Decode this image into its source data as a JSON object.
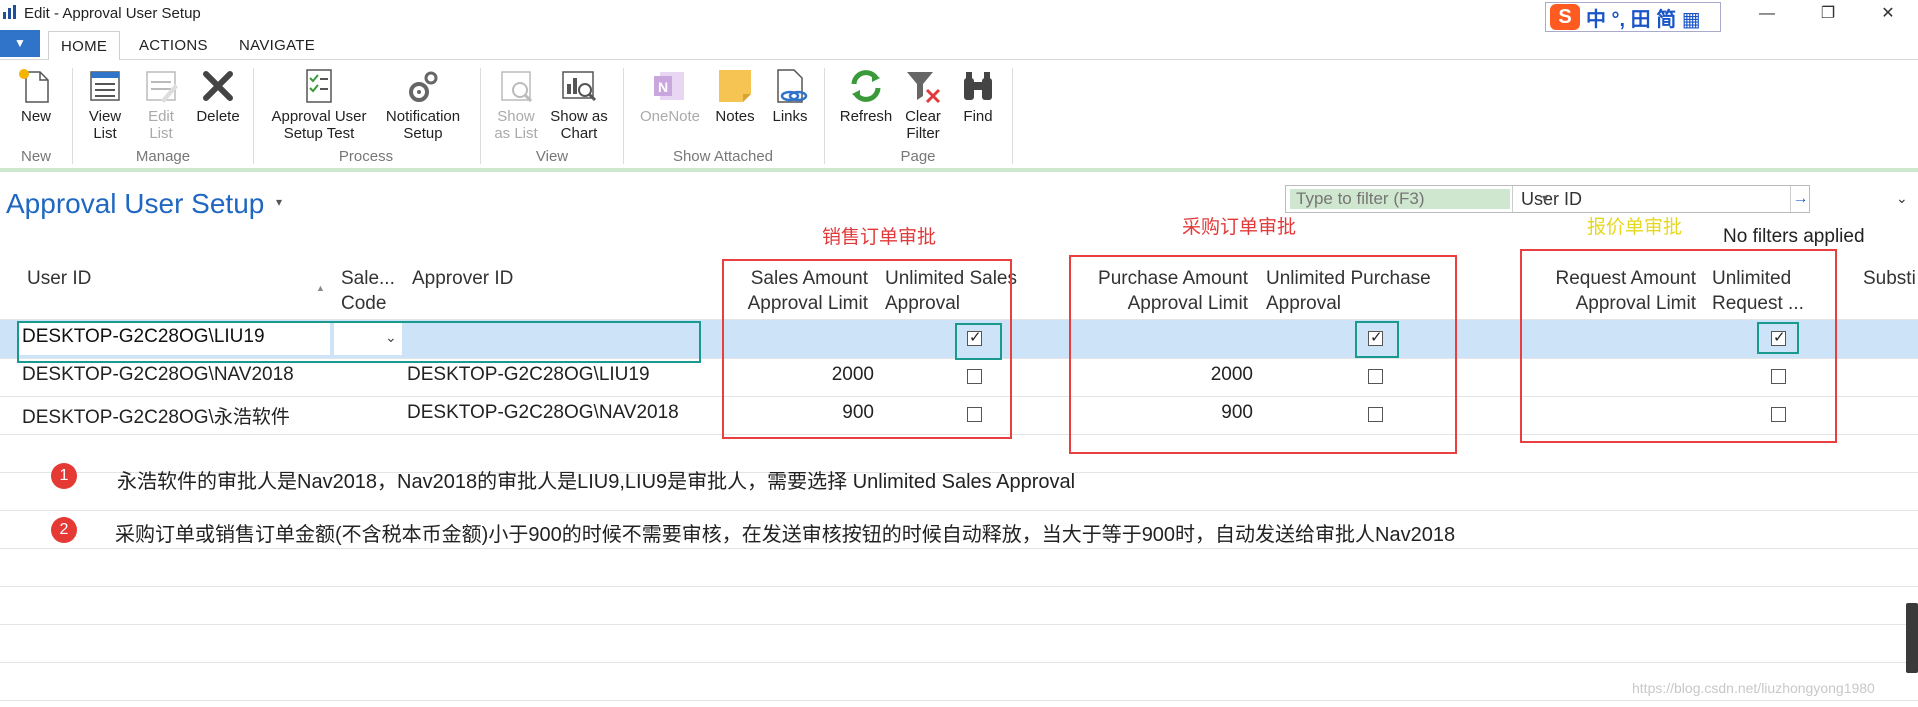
{
  "window": {
    "title": "Edit - Approval User Setup",
    "ime_glyphs": "中 °, ⽥ 简 ▦",
    "ime_logo": "S",
    "minimize": "—",
    "restore": "❐",
    "close": "✕"
  },
  "ribbon_tabs": {
    "menu": "▼",
    "items": [
      "HOME",
      "ACTIONS",
      "NAVIGATE"
    ],
    "active": "HOME"
  },
  "ribbon": {
    "groups": [
      {
        "label": "New",
        "buttons": [
          {
            "label": "New",
            "icon": "new-doc-icon"
          }
        ]
      },
      {
        "label": "Manage",
        "buttons": [
          {
            "label": "View\nList",
            "icon": "view-list-icon"
          },
          {
            "label": "Edit\nList",
            "icon": "edit-list-icon",
            "disabled": true
          },
          {
            "label": "Delete",
            "icon": "delete-icon"
          }
        ]
      },
      {
        "label": "Process",
        "buttons": [
          {
            "label": "Approval User\nSetup Test",
            "icon": "checklist-icon"
          },
          {
            "label": "Notification\nSetup",
            "icon": "gears-icon"
          }
        ]
      },
      {
        "label": "View",
        "buttons": [
          {
            "label": "Show\nas List",
            "icon": "show-list-icon",
            "disabled": true
          },
          {
            "label": "Show as\nChart",
            "icon": "chart-icon"
          }
        ]
      },
      {
        "label": "Show Attached",
        "buttons": [
          {
            "label": "OneNote",
            "icon": "onenote-icon",
            "disabled": true
          },
          {
            "label": "Notes",
            "icon": "notes-icon"
          },
          {
            "label": "Links",
            "icon": "links-icon"
          }
        ]
      },
      {
        "label": "Page",
        "buttons": [
          {
            "label": "Refresh",
            "icon": "refresh-icon"
          },
          {
            "label": "Clear\nFilter",
            "icon": "clear-filter-icon"
          },
          {
            "label": "Find",
            "icon": "binoculars-icon"
          }
        ]
      }
    ]
  },
  "page": {
    "title": "Approval User Setup",
    "title_caret": "▾",
    "filter_placeholder": "Type to filter (F3)",
    "filter_field": "User ID",
    "filter_caret": "▾",
    "filter_go": "→",
    "collapse": "⌄",
    "filter_status": "No filters applied"
  },
  "annotations": {
    "sales": "销售订单审批",
    "purchase": "采购订单审批",
    "request": "报价单审批"
  },
  "grid": {
    "headers": {
      "user_id": "User ID",
      "sales_code_1": "Sale...",
      "sales_code_2": "Code",
      "approver_id": "Approver ID",
      "sales_limit_1": "Sales Amount",
      "sales_limit_2": "Approval Limit",
      "unl_sales_1": "Unlimited Sales",
      "unl_sales_2": "Approval",
      "purch_limit_1": "Purchase Amount",
      "purch_limit_2": "Approval Limit",
      "unl_purch_1": "Unlimited Purchase",
      "unl_purch_2": "Approval",
      "req_limit_1": "Request Amount",
      "req_limit_2": "Approval Limit",
      "unl_req_1": "Unlimited",
      "unl_req_2": "Request ...",
      "substitute": "Substi"
    },
    "rows": [
      {
        "user_id": "DESKTOP-G2C28OG\\LIU19",
        "approver_id": "",
        "sales_limit": "",
        "unl_sales": true,
        "purch_limit": "",
        "unl_purch": true,
        "req_limit": "",
        "unl_req": true
      },
      {
        "user_id": "DESKTOP-G2C28OG\\NAV2018",
        "approver_id": "DESKTOP-G2C28OG\\LIU19",
        "sales_limit": "2000",
        "unl_sales": false,
        "purch_limit": "2000",
        "unl_purch": false,
        "req_limit": "",
        "unl_req": false
      },
      {
        "user_id": "DESKTOP-G2C28OG\\永浩软件",
        "approver_id": "DESKTOP-G2C28OG\\NAV2018",
        "sales_limit": "900",
        "unl_sales": false,
        "purch_limit": "900",
        "unl_purch": false,
        "req_limit": "",
        "unl_req": false
      }
    ]
  },
  "notes": [
    {
      "num": "1",
      "text": "永浩软件的审批人是Nav2018，Nav2018的审批人是LIU9,LIU9是审批人，需要选择 Unlimited Sales Approval"
    },
    {
      "num": "2",
      "text": "采购订单或销售订单金额(不含税本币金额)小于900的时候不需要审核，在发送审核按钮的时候自动释放，当大于等于900时，自动发送给审批人Nav2018"
    }
  ],
  "watermark": "https://blog.csdn.net/liuzhongyong1980"
}
